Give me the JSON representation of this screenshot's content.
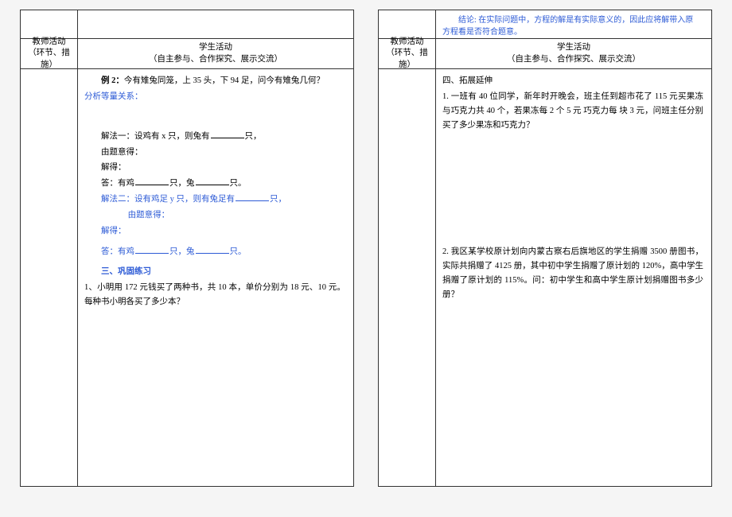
{
  "left": {
    "header": {
      "teacher_line1": "教师活动",
      "teacher_line2": "（环节、措施）",
      "student_line1": "学生活动",
      "student_line2": "（自主参与、合作探究、展示交流）"
    },
    "example2_prefix": "例 2：",
    "example2_text": "今有雉兔同笼，上 35 头，下 94 足，问今有雉兔几何？",
    "analyze_label": "分析等量关系：",
    "method1_label": "解法一：",
    "method1_text_a": "设鸡有 x 只，则兔有",
    "method1_text_b": "只，",
    "by_problem": "由题意得：",
    "solve_label": "解得：",
    "ans_prefix": "答：有鸡",
    "ans_mid": "只，兔",
    "ans_suffix": "只。",
    "method2_label": "解法二：",
    "method2_text_a": "设有鸡足 y 只，则有兔足有",
    "method2_text_b": "只，",
    "by_problem2": "由题意得：",
    "solve_label2": "解得：",
    "ans2_prefix": "答：有鸡",
    "ans2_mid": "只，兔",
    "ans2_suffix": "只。",
    "section3": "三、巩固练习",
    "q1": "1、小明用 172 元钱买了两种书，共 10 本，单价分别为 18 元、10 元。每种书小明各买了多少本？"
  },
  "right": {
    "conclusion": "结论: 在实际问题中，方程的解是有实际意义的，因此应将解带入原方程看是否符合题意。",
    "header": {
      "teacher_line1": "教师活动",
      "teacher_line2": "（环节、措施）",
      "student_line1": "学生活动",
      "student_line2": "（自主参与、合作探究、展示交流）"
    },
    "section4": "四、拓展延伸",
    "q1": "1. 一班有 40 位同学，新年时开晚会，班主任到超市花了 115 元买果冻与巧克力共 40 个，若果冻每 2 个 5 元  巧克力每  块 3 元，问班主任分别买了多少果冻和巧克力？",
    "q2": "2. 我区某学校原计划向内蒙古察右后旗地区的学生捐赠 3500 册图书，实际共捐赠了 4125 册，其中初中学生捐赠了原计划的 120%，高中学生捐赠了原计划的 115%。问：初中学生和高中学生原计划捐赠图书多少册？"
  }
}
